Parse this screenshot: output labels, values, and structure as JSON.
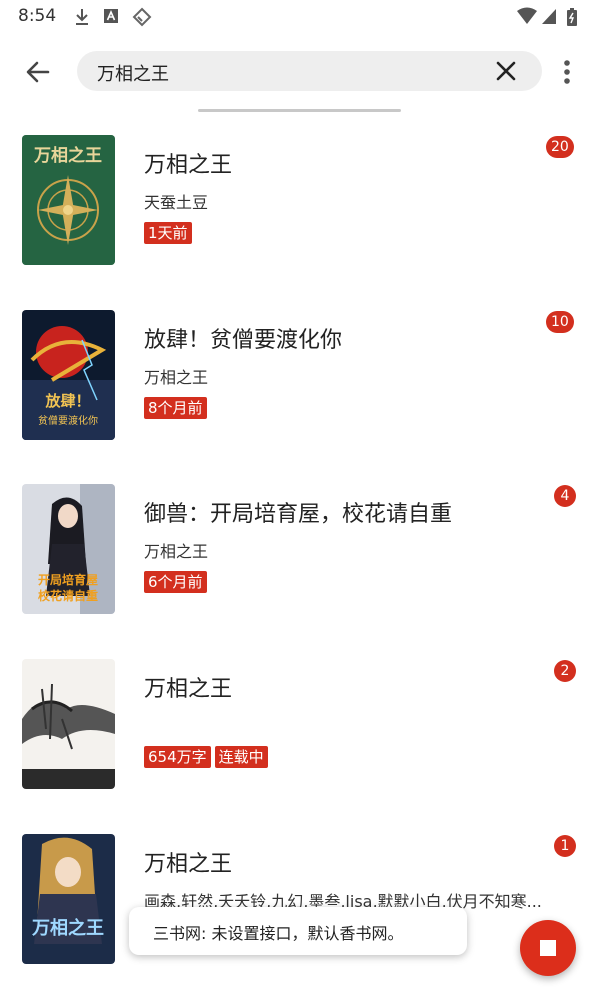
{
  "status_bar": {
    "time": "8:54",
    "icons": [
      "download-icon",
      "a-letter-icon",
      "tag-icon",
      "wifi-icon",
      "signal-icon",
      "battery-icon"
    ]
  },
  "search": {
    "value": "万相之王"
  },
  "colors": {
    "accent": "#d32f1e",
    "search_bg": "#eeeeee"
  },
  "books": [
    {
      "title": "万相之王",
      "subtitle": "天蚕土豆",
      "tags": [
        "1天前"
      ],
      "badge": "20",
      "cover_text": "万相之王"
    },
    {
      "title": "放肆！贫僧要渡化你",
      "subtitle": "万相之王",
      "tags": [
        "8个月前"
      ],
      "badge": "10",
      "cover_text": "放肆！贫僧要渡化你"
    },
    {
      "title": "御兽：开局培育屋，校花请自重",
      "subtitle": "万相之王",
      "tags": [
        "6个月前"
      ],
      "badge": "4",
      "cover_text": "开局培育屋 校花请自重"
    },
    {
      "title": "万相之王",
      "subtitle": "",
      "tags": [
        "654万字",
        "连载中"
      ],
      "badge": "2",
      "cover_text": ""
    },
    {
      "title": "万相之王",
      "subtitle": "画森,轩然,夭夭铃,九幻,墨叁,lisa,默默小白,伏月不知寒...",
      "tags": [],
      "badge": "1",
      "cover_text": "万相之王"
    }
  ],
  "toast": {
    "text": "三书网: 未设置接口，默认香书网。"
  }
}
